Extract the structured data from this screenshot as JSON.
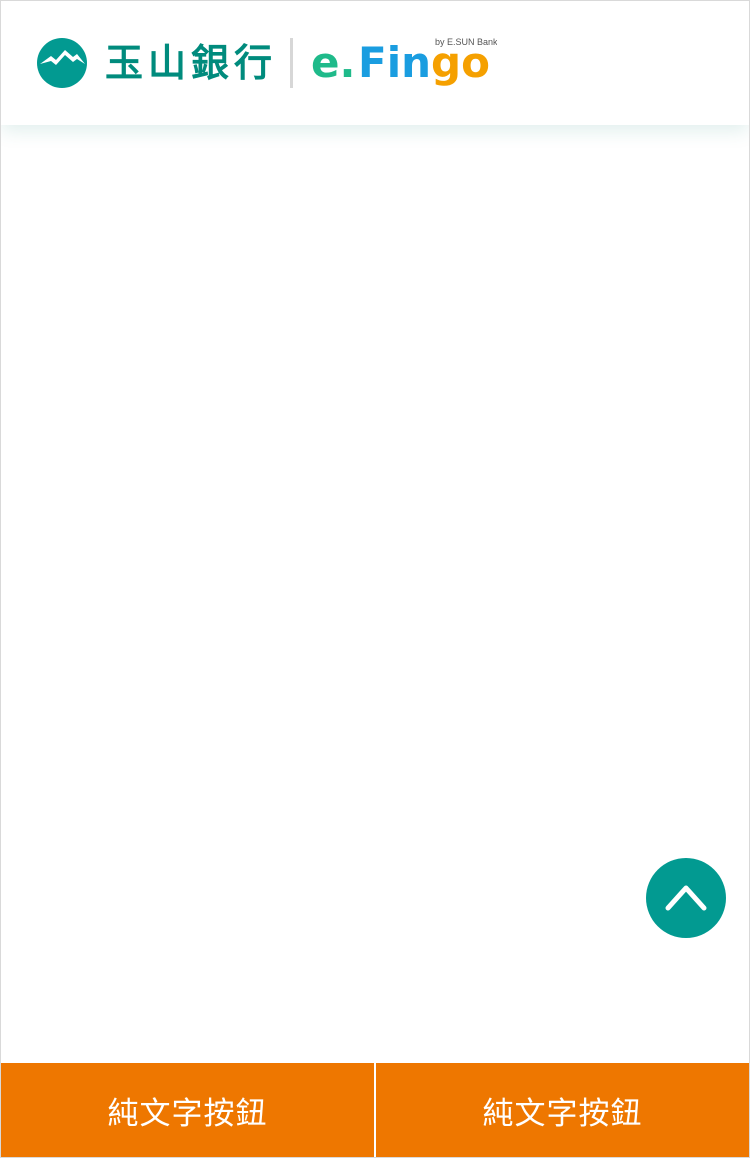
{
  "header": {
    "bank_name": "玉山銀行",
    "app_logo": {
      "text_e": "e.",
      "text_fin": "Fin",
      "text_go": "go",
      "tagline": "by E.SUN Bank"
    },
    "colors": {
      "brand_teal": "#008b7d",
      "logo_green": "#1fba8a",
      "logo_blue": "#1a9de0",
      "logo_orange": "#f5a000",
      "logo_red": "#ee4c3b"
    }
  },
  "back_to_top": {
    "icon": "chevron-up-icon",
    "color": "#029a91"
  },
  "bottom_bar": {
    "buttons": [
      {
        "label": "純文字按鈕"
      },
      {
        "label": "純文字按鈕"
      }
    ],
    "color": "#ee7700"
  }
}
